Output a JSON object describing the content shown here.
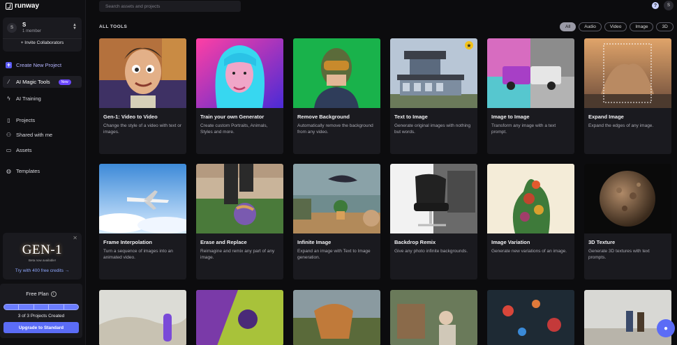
{
  "app": {
    "name": "runway"
  },
  "team": {
    "avatar": "S",
    "name": "S",
    "members": "1 member",
    "invite": "+ Invite Collaborators"
  },
  "nav": {
    "create": "Create New Project",
    "magic_tools": "AI Magic Tools",
    "magic_badge": "New",
    "training": "AI Training",
    "projects": "Projects",
    "shared": "Shared with me",
    "assets": "Assets",
    "templates": "Templates"
  },
  "promo": {
    "title": "GEN-1",
    "subtitle": "Beta now available!",
    "link": "Try with 400 free credits →",
    "close": "✕"
  },
  "plan": {
    "title": "Free Plan",
    "info": "i",
    "progress": 1.0,
    "count": "3 of 3 Projects Created",
    "upgrade": "Upgrade to Standard"
  },
  "search": {
    "placeholder": "Search assets and projects"
  },
  "header": {
    "help": "?",
    "user": "S"
  },
  "section": {
    "title": "ALL TOOLS"
  },
  "filters": [
    "All",
    "Audio",
    "Video",
    "Image",
    "3D"
  ],
  "active_filter": "All",
  "cards": [
    {
      "title": "Gen-1: Video to Video",
      "desc": "Change the style of a video with text or images."
    },
    {
      "title": "Train your own Generator",
      "desc": "Create custom Portraits, Animals, Styles and more."
    },
    {
      "title": "Remove Background",
      "desc": "Automatically remove the background from any video."
    },
    {
      "title": "Text to Image",
      "desc": "Generate original images with nothing but words."
    },
    {
      "title": "Image to Image",
      "desc": "Transform any image with a text prompt."
    },
    {
      "title": "Expand Image",
      "desc": "Expand the edges of any image."
    },
    {
      "title": "Frame Interpolation",
      "desc": "Turn a sequence of images into an animated video."
    },
    {
      "title": "Erase and Replace",
      "desc": "Reimagine and remix any part of any image."
    },
    {
      "title": "Infinite Image",
      "desc": "Expand an image with Text to Image generation."
    },
    {
      "title": "Backdrop Remix",
      "desc": "Give any photo infinite backgrounds."
    },
    {
      "title": "Image Variation",
      "desc": "Generate new variations of an image."
    },
    {
      "title": "3D Texture",
      "desc": "Generate 3D textures with text prompts."
    }
  ],
  "colors": {
    "accent": "#5b6cf6",
    "badge": "#6b47ff",
    "background": "#0c0c0e",
    "card": "#1a1a1f"
  }
}
